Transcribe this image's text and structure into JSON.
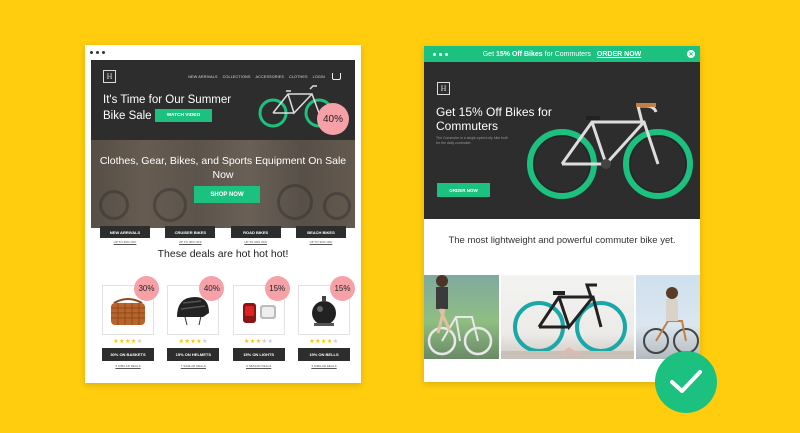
{
  "colors": {
    "background": "#ffcd0d",
    "accent": "#1cc07f",
    "dark": "#2d2d2d",
    "badge": "#f6a0a8"
  },
  "left": {
    "logo": "H",
    "nav": [
      "NEW ARRIVALS",
      "COLLECTIONS",
      "ACCESSORIES",
      "CLOTHES",
      "LOGIN"
    ],
    "hero_title": "It's Time for Our Summer Bike Sale",
    "watch_button": "WATCH VIDEO",
    "hero_badge": "40%",
    "band_text": "Clothes, Gear, Bikes, and Sports Equipment On Sale Now",
    "shop_button": "SHOP NOW",
    "categories": [
      {
        "label": "NEW ARRIVALS",
        "sub": "UP TO 30% OFF"
      },
      {
        "label": "CRUISER BIKES",
        "sub": "UP TO 30% OFF"
      },
      {
        "label": "ROAD BIKES",
        "sub": "UP TO 30% OFF"
      },
      {
        "label": "BEACH BIKES",
        "sub": "UP TO 30% OFF"
      }
    ],
    "deals_heading": "These deals are hot hot hot!",
    "products": [
      {
        "badge": "30%",
        "stars": 4,
        "button": "30% ON BASKETS",
        "sub": "5 SIMILAR DEALS"
      },
      {
        "badge": "40%",
        "stars": 4,
        "button": "15% ON HELMETS",
        "sub": "7 SIMILAR DEALS"
      },
      {
        "badge": "15%",
        "stars": 3,
        "button": "15% ON LIGHTS",
        "sub": "9 SIMILAR DEALS"
      },
      {
        "badge": "15%",
        "stars": 4,
        "button": "15% ON BELLS",
        "sub": "4 SIMILAR DEALS"
      }
    ]
  },
  "right": {
    "topbar_prefix": "Get",
    "topbar_bold": "15% Off Bikes",
    "topbar_suffix": "for Commuters",
    "topbar_link": "ORDER NOW",
    "logo": "H",
    "hero_title": "Get 15% Off Bikes for Commuters",
    "hero_desc": "The Commuter is a single-speed city bike built for the daily commuter.",
    "order_button": "ORDER NOW",
    "tagline": "The most lightweight and powerful commuter bike yet."
  }
}
